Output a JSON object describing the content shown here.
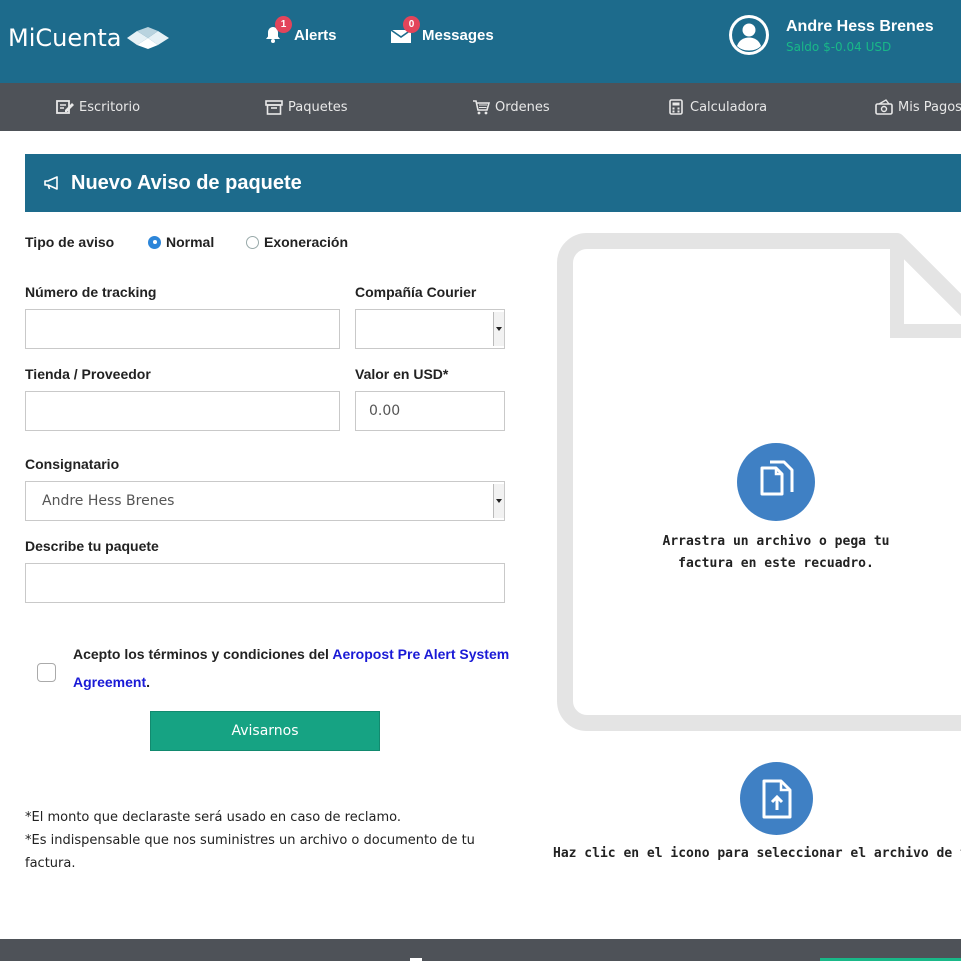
{
  "header": {
    "brand": "MiCuenta",
    "alerts": {
      "label": "Alerts",
      "count": "1"
    },
    "messages": {
      "label": "Messages",
      "count": "0"
    },
    "user": {
      "name": "Andre Hess Brenes",
      "balance": "Saldo $-0.04 USD"
    }
  },
  "nav": {
    "items": [
      {
        "label": "Escritorio",
        "icon": "edit-icon"
      },
      {
        "label": "Paquetes",
        "icon": "archive-icon"
      },
      {
        "label": "Ordenes",
        "icon": "cart-icon"
      },
      {
        "label": "Calculadora",
        "icon": "calculator-icon"
      },
      {
        "label": "Mis Pagos",
        "icon": "money-icon"
      }
    ]
  },
  "panel": {
    "title": "Nuevo Aviso de paquete",
    "icon": "megaphone-icon"
  },
  "form": {
    "tipo_label": "Tipo de aviso",
    "radio_normal": "Normal",
    "radio_exoneracion": "Exoneración",
    "selected_tipo": "Normal",
    "tracking_label": "Número de tracking",
    "tracking_value": "",
    "courier_label": "Compañía Courier",
    "courier_value": "",
    "tienda_label": "Tienda / Proveedor",
    "tienda_value": "",
    "valor_label": "Valor en USD*",
    "valor_value": "0.00",
    "consignatario_label": "Consignatario",
    "consignatario_value": "Andre Hess Brenes",
    "describe_label": "Describe tu paquete",
    "describe_value": "",
    "terms_text": "Acepto los términos y condiciones del ",
    "terms_link": "Aeropost Pre Alert System Agreement",
    "terms_end": ".",
    "terms_checked": false,
    "submit": "Avisarnos",
    "note1": "*El monto que declaraste será usado en caso de reclamo.",
    "note2": "*Es indispensable que nos suministres un archivo o documento de tu factura."
  },
  "dropzone": {
    "text": "Arrastra un archivo o pega tu factura en este recuadro.",
    "upload_text": "Haz clic en el icono para seleccionar el archivo de tu factura."
  },
  "colors": {
    "header": "#1d6b8c",
    "subnav": "#4e5258",
    "accent_green": "#16a383",
    "badge": "#e3445a",
    "icon_blue": "#3f80c4"
  }
}
